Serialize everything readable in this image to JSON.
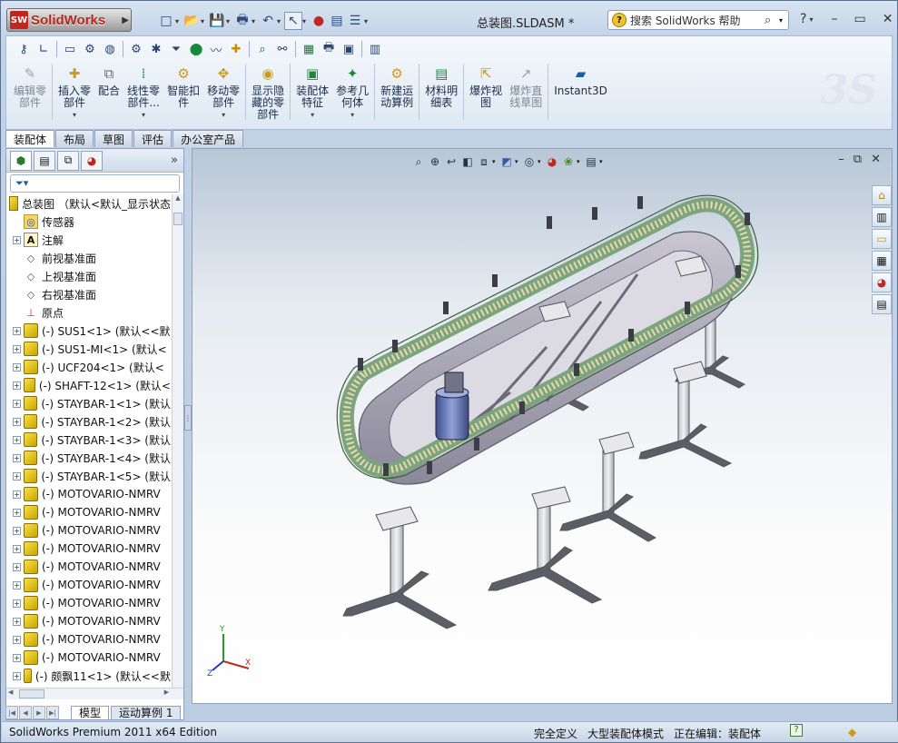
{
  "app": {
    "logo_text": "SolidWorks",
    "logo_badge": "SW",
    "document_title": "总装图.SLDASM *",
    "search_placeholder": "搜索 SolidWorks 帮助",
    "help_label": "?"
  },
  "ribbon": {
    "buttons": [
      {
        "label": "编辑零\n部件",
        "disabled": true,
        "icon": "edit-component-icon"
      },
      {
        "label": "插入零\n部件",
        "dropdown": true,
        "icon": "insert-component-icon"
      },
      {
        "label": "配合",
        "icon": "mate-icon"
      },
      {
        "label": "线性零\n部件...",
        "dropdown": true,
        "icon": "linear-pattern-icon"
      },
      {
        "label": "智能扣\n件",
        "icon": "smart-fasteners-icon"
      },
      {
        "label": "移动零\n部件",
        "dropdown": true,
        "icon": "move-component-icon"
      },
      {
        "label": "显示隐\n藏的零\n部件",
        "icon": "show-hidden-icon"
      },
      {
        "label": "装配体\n特征",
        "dropdown": true,
        "icon": "assembly-feature-icon"
      },
      {
        "label": "参考几\n何体",
        "dropdown": true,
        "icon": "reference-geometry-icon"
      },
      {
        "label": "新建运\n动算例",
        "icon": "new-motion-study-icon"
      },
      {
        "label": "材料明\n细表",
        "icon": "bill-of-materials-icon"
      },
      {
        "label": "爆炸视\n图",
        "icon": "exploded-view-icon"
      },
      {
        "label": "爆炸直\n线草图",
        "disabled": true,
        "icon": "explode-line-sketch-icon"
      },
      {
        "label": "Instant3D",
        "icon": "instant3d-icon"
      }
    ]
  },
  "command_tabs": [
    "装配体",
    "布局",
    "草图",
    "评估",
    "办公室产品"
  ],
  "tree": {
    "root": "总装图 （默认<默认_显示状态",
    "nodes": [
      {
        "label": "传感器",
        "type": "folder",
        "expander": false
      },
      {
        "label": "注解",
        "type": "annotation",
        "expander": true
      },
      {
        "label": "前视基准面",
        "type": "plane",
        "expander": false
      },
      {
        "label": "上视基准面",
        "type": "plane",
        "expander": false
      },
      {
        "label": "右视基准面",
        "type": "plane",
        "expander": false
      },
      {
        "label": "原点",
        "type": "origin",
        "expander": false
      },
      {
        "label": "(-) SUS1<1> (默认<<默",
        "type": "part",
        "expander": true
      },
      {
        "label": "(-) SUS1-MI<1> (默认<",
        "type": "part",
        "expander": true
      },
      {
        "label": "(-) UCF204<1> (默认<",
        "type": "part",
        "expander": true
      },
      {
        "label": "(-) SHAFT-12<1> (默认<",
        "type": "part",
        "expander": true
      },
      {
        "label": "(-) STAYBAR-1<1> (默认",
        "type": "part",
        "expander": true
      },
      {
        "label": "(-) STAYBAR-1<2> (默认",
        "type": "part",
        "expander": true
      },
      {
        "label": "(-) STAYBAR-1<3> (默认",
        "type": "part",
        "expander": true
      },
      {
        "label": "(-) STAYBAR-1<4> (默认",
        "type": "part",
        "expander": true
      },
      {
        "label": "(-) STAYBAR-1<5> (默认",
        "type": "part",
        "expander": true
      },
      {
        "label": "(-) MOTOVARIO-NMRV",
        "type": "part",
        "expander": true
      },
      {
        "label": "(-) MOTOVARIO-NMRV",
        "type": "part",
        "expander": true
      },
      {
        "label": "(-) MOTOVARIO-NMRV",
        "type": "part",
        "expander": true
      },
      {
        "label": "(-) MOTOVARIO-NMRV",
        "type": "part",
        "expander": true
      },
      {
        "label": "(-) MOTOVARIO-NMRV",
        "type": "part",
        "expander": true
      },
      {
        "label": "(-) MOTOVARIO-NMRV",
        "type": "part",
        "expander": true
      },
      {
        "label": "(-) MOTOVARIO-NMRV",
        "type": "part",
        "expander": true
      },
      {
        "label": "(-) MOTOVARIO-NMRV",
        "type": "part",
        "expander": true
      },
      {
        "label": "(-) MOTOVARIO-NMRV",
        "type": "part",
        "expander": true
      },
      {
        "label": "(-) MOTOVARIO-NMRV",
        "type": "part",
        "expander": true
      },
      {
        "label": "(-) 颇飘11<1> (默认<<默",
        "type": "part",
        "expander": true
      }
    ]
  },
  "bottom_tabs": [
    "模型",
    "运动算例 1"
  ],
  "triad": {
    "x": "X",
    "y": "Y",
    "z": "Z"
  },
  "status": {
    "edition": "SolidWorks Premium 2011 x64 Edition",
    "definition": "完全定义",
    "mode": "大型装配体模式",
    "editing": "正在编辑：装配体"
  },
  "colors": {
    "accent": "#1e5ba6",
    "belt_green": "#7da57d",
    "frame": "#9c9aa7",
    "brand_red": "#c0281f"
  }
}
